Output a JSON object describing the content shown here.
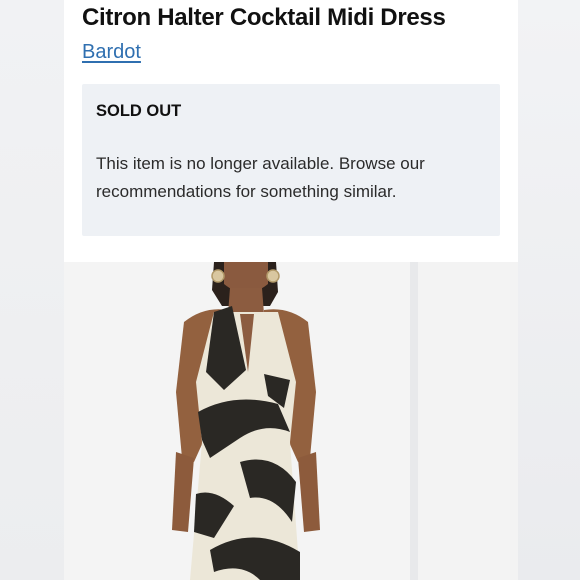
{
  "product": {
    "title": "Citron Halter Cocktail Midi Dress",
    "brand": "Bardot"
  },
  "availability": {
    "status": "SOLD OUT",
    "message": "This item is no longer available. Browse our recommendations for something similar."
  },
  "colors": {
    "brand_link": "#2f6fb0",
    "notice_bg": "#eef1f5",
    "dress_dark": "#2a2824",
    "dress_light": "#ece7d8"
  }
}
